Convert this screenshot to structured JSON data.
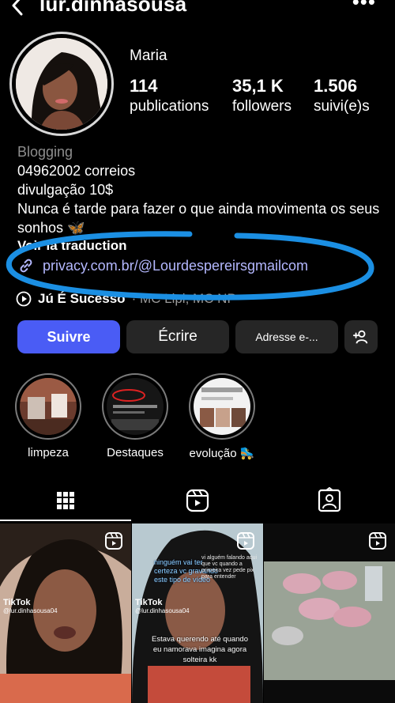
{
  "header": {
    "username": "lur.dinhasousa",
    "back_icon": "chevron-left-icon",
    "more_icon": "more-horizontal-icon"
  },
  "profile": {
    "name": "Maria",
    "stats": [
      {
        "value": "114",
        "label": "publications"
      },
      {
        "value": "35,1 K",
        "label": "followers"
      },
      {
        "value": "1.506",
        "label": "suivi(e)s"
      }
    ]
  },
  "bio": {
    "category": "Blogging",
    "lines": [
      "04962002 correios",
      "divulgação 10$",
      "Nunca é tarde para fazer o que ainda movimenta os seus sonhos 🦋"
    ],
    "translate": "Voir la traduction",
    "link": "privacy.com.br/@Lourdespereirsgmailcom",
    "music_title": "Jú É Sucesso",
    "music_artist": "· MC Lipi, MC NP"
  },
  "annotation": {
    "color": "#1b8fe3"
  },
  "buttons": {
    "follow": "Suivre",
    "message": "Écrire",
    "email": "Adresse e-...",
    "add_user_icon": "add-user-icon"
  },
  "highlights": [
    {
      "label": "limpeza"
    },
    {
      "label": "Destaques"
    },
    {
      "label": "evolução 🛼"
    }
  ],
  "tabs": [
    {
      "icon": "grid-icon",
      "active": true
    },
    {
      "icon": "reels-icon",
      "active": false
    },
    {
      "icon": "tagged-icon",
      "active": false
    }
  ],
  "posts": [
    {
      "tiktok_brand": "TikTok",
      "tiktok_handle": "@lur.dinhasousa04"
    },
    {
      "tiktok_brand": "TikTok",
      "tiktok_handle": "@lur.dinhasousa04",
      "blue_caption": "ninguém vai ter certeza vc gravando este tipo de vídeo",
      "small_caption": "vi alguém falando aqui que vc quando a primeira vez pede pix para entender",
      "caption": "Estava querendo até quando eu namorava imagina agora solteira kk"
    },
    {}
  ],
  "colors": {
    "accent": "#4a5cf5",
    "link": "#b4b8ff",
    "button_bg": "#262626",
    "muted": "#8e8e8e"
  }
}
